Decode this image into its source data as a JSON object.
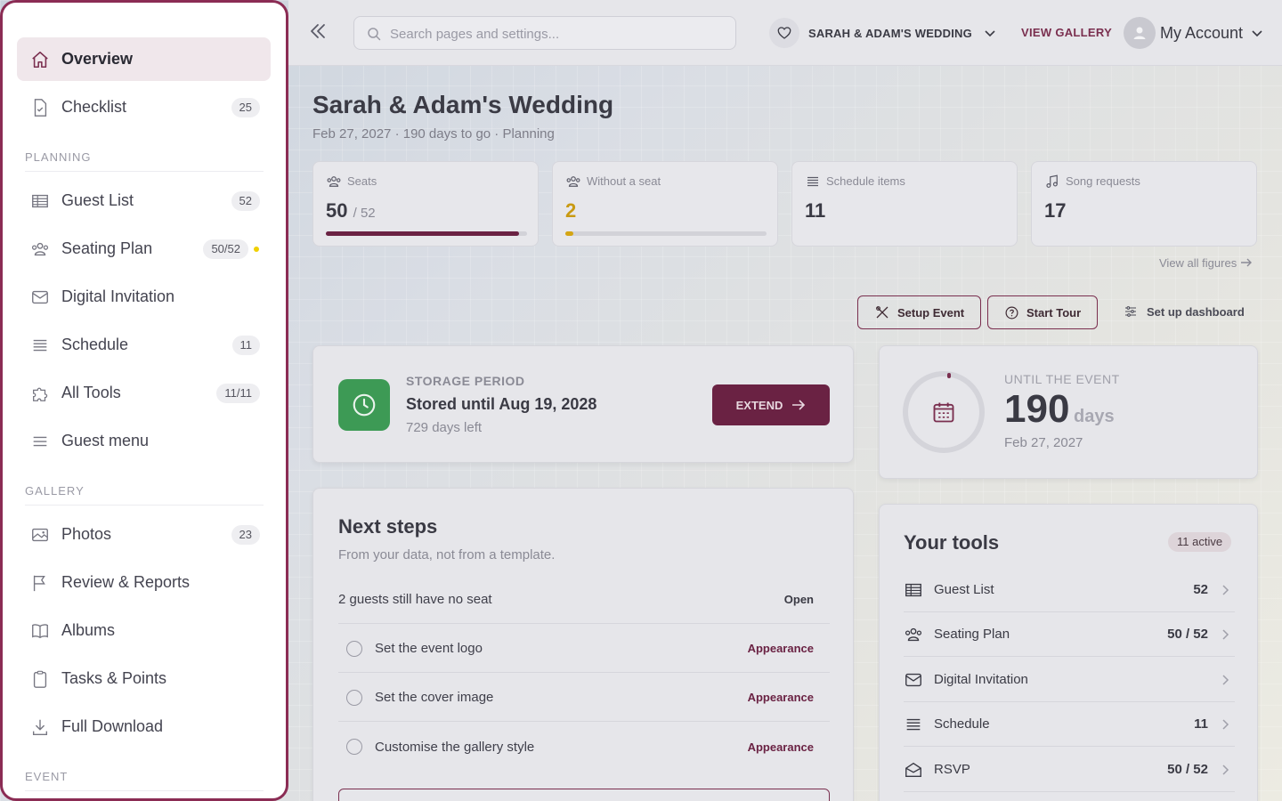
{
  "sidebar": {
    "items_top": [
      {
        "label": "Overview",
        "icon": "home-icon",
        "active": true
      },
      {
        "label": "Checklist",
        "icon": "checklist-icon",
        "count": "25"
      }
    ],
    "sections": [
      "PLANNING",
      "GALLERY",
      "EVENT"
    ],
    "planning": [
      {
        "label": "Guest List",
        "icon": "table-icon",
        "count": "52"
      },
      {
        "label": "Seating Plan",
        "icon": "users-icon",
        "count": "50/52",
        "status_dot": "#f0d000"
      },
      {
        "label": "Digital Invitation",
        "icon": "envelope-icon"
      },
      {
        "label": "Schedule",
        "icon": "list-icon",
        "count": "11"
      },
      {
        "label": "All Tools",
        "icon": "puzzle-icon",
        "count": "11/11"
      },
      {
        "label": "Guest menu",
        "icon": "menu-icon"
      }
    ],
    "gallery": [
      {
        "label": "Photos",
        "icon": "image-icon",
        "count": "23"
      },
      {
        "label": "Review & Reports",
        "icon": "flag-icon"
      },
      {
        "label": "Albums",
        "icon": "book-icon"
      },
      {
        "label": "Tasks & Points",
        "icon": "clipboard-icon"
      },
      {
        "label": "Full Download",
        "icon": "download-icon"
      }
    ]
  },
  "topbar": {
    "search_placeholder": "Search pages and settings...",
    "event_name": "SARAH & ADAM'S WEDDING",
    "view_gallery": "VIEW GALLERY",
    "account": "My Account"
  },
  "header": {
    "title": "Sarah & Adam's Wedding",
    "subtitle": "Feb 27, 2027 · 190 days to go · Planning"
  },
  "stats": [
    {
      "label": "Seats",
      "value": "50",
      "of": "/ 52",
      "progress": 0.96,
      "bar_color": "#6a2243"
    },
    {
      "label": "Without a seat",
      "value": "2",
      "progress": 0.04,
      "bar_color": "#d4a514",
      "value_color": "#c99a12"
    },
    {
      "label": "Schedule items",
      "value": "11"
    },
    {
      "label": "Song requests",
      "value": "17"
    }
  ],
  "view_all_figures": "View all figures",
  "actions": {
    "setup_event": "Setup Event",
    "start_tour": "Start Tour",
    "setup_dashboard": "Set up dashboard"
  },
  "storage": {
    "caption": "STORAGE PERIOD",
    "text": "Stored until Aug 19, 2028",
    "sub": "729 days left",
    "button": "EXTEND"
  },
  "countdown": {
    "caption": "UNTIL THE EVENT",
    "days": "190",
    "unit": "days",
    "date": "Feb 27, 2027"
  },
  "next_steps": {
    "title": "Next steps",
    "subtitle": "From your data, not from a template.",
    "items": [
      {
        "text": "2 guests still have no seat",
        "action": "Open",
        "checkbox": false
      },
      {
        "text": "Set the event logo",
        "action": "Appearance",
        "checkbox": true
      },
      {
        "text": "Set the cover image",
        "action": "Appearance",
        "checkbox": true
      },
      {
        "text": "Customise the gallery style",
        "action": "Appearance",
        "checkbox": true
      }
    ]
  },
  "tools": {
    "title": "Your tools",
    "badge": "11 active",
    "items": [
      {
        "name": "Guest List",
        "value": "52",
        "icon": "table-icon"
      },
      {
        "name": "Seating Plan",
        "value": "50 / 52",
        "icon": "users-icon"
      },
      {
        "name": "Digital Invitation",
        "value": "",
        "icon": "envelope-icon"
      },
      {
        "name": "Schedule",
        "value": "11",
        "icon": "list-icon"
      },
      {
        "name": "RSVP",
        "value": "50 / 52",
        "icon": "envelope-open-icon"
      }
    ]
  }
}
